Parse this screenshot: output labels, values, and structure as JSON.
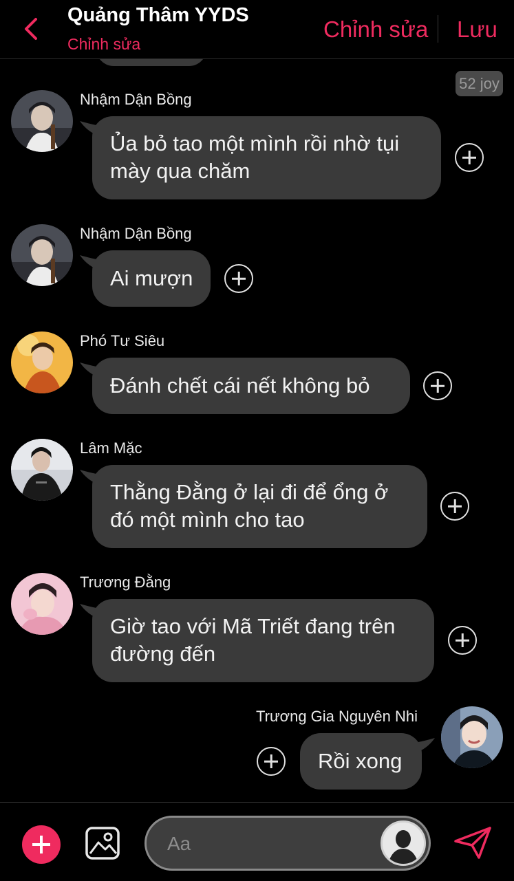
{
  "header": {
    "title": "Quảng Thâm YYDS",
    "subtitle": "Chỉnh sửa",
    "edit_label": "Chỉnh sửa",
    "save_label": "Lưu"
  },
  "counter": "52 joy",
  "messages": [
    {
      "sender": "Nhậm Dận Bồng",
      "line1": "Ủa bỏ tao một mình rồi nhờ tụi",
      "line2": "mày qua chăm"
    },
    {
      "sender": "Nhậm Dận Bồng",
      "line1": "Ai mượn"
    },
    {
      "sender": "Phó Tư Siêu",
      "line1": "Đánh chết cái nết không bỏ"
    },
    {
      "sender": "Lâm Mặc",
      "line1": "Thằng Đằng ở lại đi để ổng ở",
      "line2": "đó một mình cho tao"
    },
    {
      "sender": "Trương Đằng",
      "line1": "Giờ tao với Mã Triết đang trên",
      "line2": "đường đến"
    },
    {
      "sender": "Trương Gia Nguyên Nhi",
      "line1": "Rồi xong"
    }
  ],
  "composer": {
    "placeholder": "Aa"
  },
  "colors": {
    "accent": "#ef2b5f",
    "bubble": "#3a3a3a",
    "background": "#000000"
  },
  "icons": {
    "back": "chevron-left-icon",
    "react": "plus-circle-icon",
    "attach": "plus-icon",
    "gallery": "image-icon",
    "send": "send-icon"
  }
}
